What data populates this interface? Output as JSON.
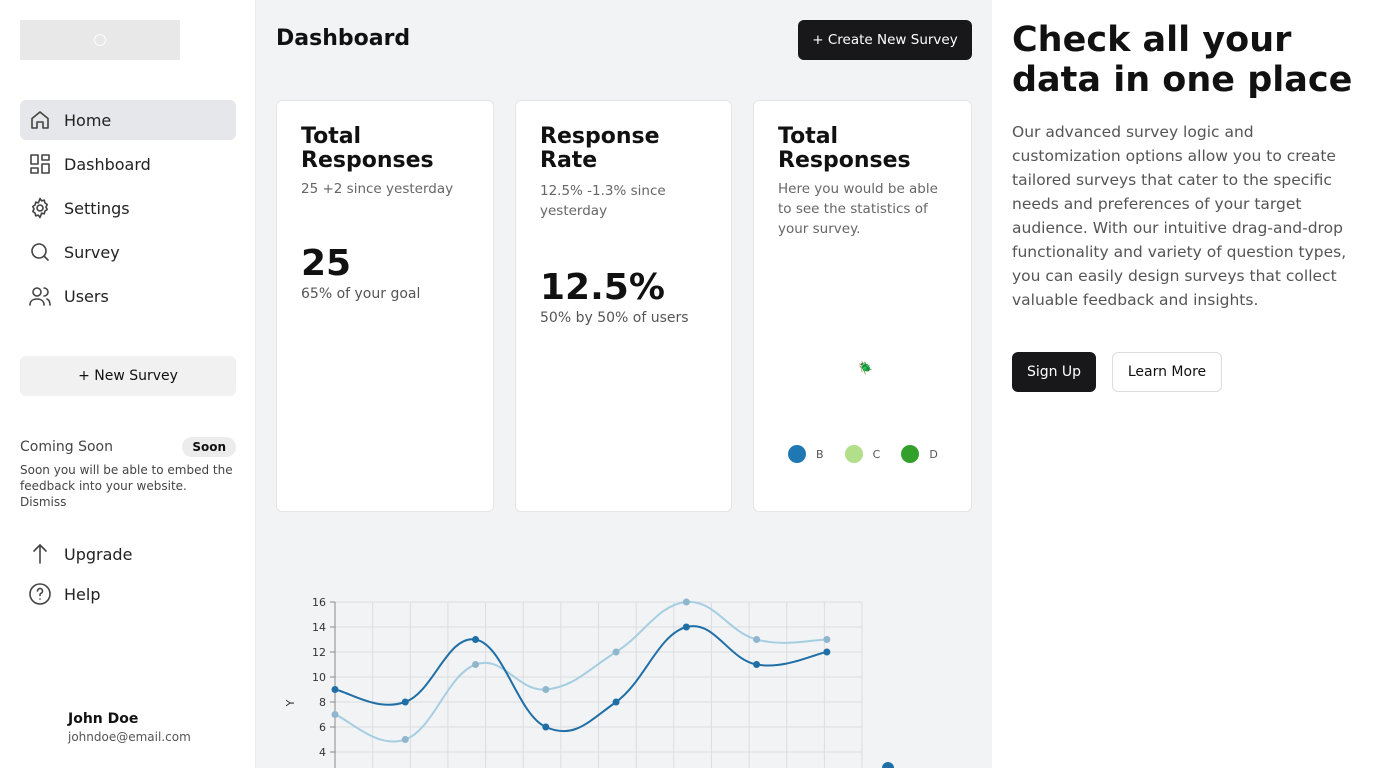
{
  "sidebar": {
    "logo_icon": "flower-logo-icon",
    "items": [
      {
        "label": "Home",
        "icon": "home-icon",
        "active": true
      },
      {
        "label": "Dashboard",
        "icon": "dashboard-grid-icon"
      },
      {
        "label": "Settings",
        "icon": "gear-icon"
      },
      {
        "label": "Survey",
        "icon": "search-icon"
      },
      {
        "label": "Users",
        "icon": "users-icon"
      }
    ],
    "new_survey_label": "+ New Survey",
    "coming_soon": {
      "title": "Coming Soon",
      "badge": "Soon",
      "text": "Soon you will be able to embed the feedback into your website.",
      "dismiss": "Dismiss"
    },
    "secondary_items": [
      {
        "label": "Upgrade",
        "icon": "arrow-up-icon"
      },
      {
        "label": "Help",
        "icon": "help-circle-icon"
      }
    ],
    "user": {
      "name": "John Doe",
      "email": "johndoe@email.com"
    }
  },
  "main": {
    "title": "Dashboard",
    "create_label": "+ Create New Survey",
    "cards": [
      {
        "title": "Total Responses",
        "sub": "25 +2 since yesterday",
        "value": "25",
        "note": "65% of your goal"
      },
      {
        "title": "Response Rate",
        "sub": "12.5% -1.3% since yesterday",
        "value": "12.5%",
        "note": "50% by 50% of users"
      },
      {
        "title": "Total Responses",
        "sub": "Here you would be able to see the statistics of your survey.",
        "legend": [
          {
            "label": "B",
            "color": "#1f77b4"
          },
          {
            "label": "C",
            "color": "#b2df8a"
          },
          {
            "label": "D",
            "color": "#33a02c"
          },
          {
            "label": "",
            "color": "#fb9a99"
          }
        ]
      }
    ]
  },
  "chart_data": {
    "type": "line",
    "title": "",
    "xlabel": "",
    "ylabel": "Y",
    "ylim": [
      3,
      16
    ],
    "yticks": [
      4,
      6,
      8,
      10,
      12,
      14,
      16
    ],
    "x": [
      0,
      1,
      2,
      3,
      4,
      5,
      6,
      7
    ],
    "grid": true,
    "series": [
      {
        "values": [
          9,
          8,
          13,
          6,
          8,
          14,
          11,
          12
        ],
        "color": "#1f6fa6"
      },
      {
        "values": [
          7,
          5,
          11,
          9,
          12,
          16,
          13,
          13
        ],
        "color": "#a6cee3"
      }
    ]
  },
  "hero": {
    "title": "Check all your data in one place",
    "text": "Our advanced survey logic and customization options allow you to create tailored surveys that cater to the specific needs and preferences of your target audience. With our intuitive drag-and-drop functionality and variety of question types, you can easily design surveys that collect valuable feedback and insights.",
    "signup_label": "Sign Up",
    "learn_label": "Learn More"
  }
}
